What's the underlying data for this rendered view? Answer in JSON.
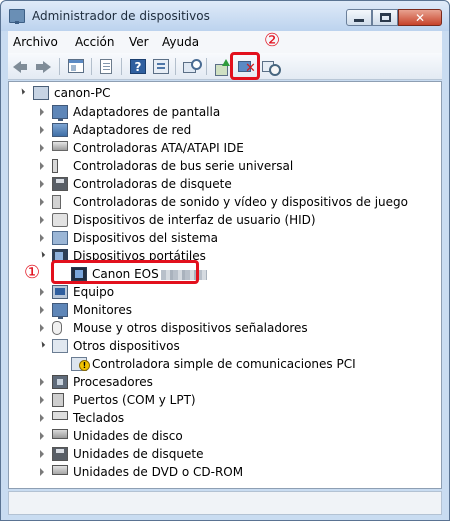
{
  "window": {
    "title": "Administrador de dispositivos"
  },
  "menu": [
    "Archivo",
    "Acción",
    "Ver",
    "Ayuda"
  ],
  "toolbar": {
    "buttons": [
      "back-icon",
      "forward-icon",
      "show-hide-tree-icon",
      "properties-doc-icon",
      "help-icon",
      "properties-icon",
      "scan-hardware-icon",
      "update-driver-icon",
      "uninstall-icon",
      "scan-changes-icon"
    ]
  },
  "callouts": {
    "first": "①",
    "second": "②"
  },
  "tree": {
    "root": "canon-PC",
    "items": [
      {
        "label": "Adaptadores de pantalla",
        "icon": "display-adapter-icon"
      },
      {
        "label": "Adaptadores de red",
        "icon": "network-adapter-icon"
      },
      {
        "label": "Controladoras ATA/ATAPI IDE",
        "icon": "ide-controller-icon"
      },
      {
        "label": "Controladoras de bus serie universal",
        "icon": "usb-icon"
      },
      {
        "label": "Controladoras de disquete",
        "icon": "floppy-controller-icon"
      },
      {
        "label": "Controladoras de sonido y vídeo y dispositivos de juego",
        "icon": "speaker-icon"
      },
      {
        "label": "Dispositivos de interfaz de usuario (HID)",
        "icon": "hid-icon"
      },
      {
        "label": "Dispositivos del sistema",
        "icon": "system-device-icon"
      },
      {
        "label": "Dispositivos portátiles",
        "icon": "portable-device-icon"
      },
      {
        "label": "Canon EOS",
        "icon": "camera-icon"
      },
      {
        "label": "Equipo",
        "icon": "computer-icon"
      },
      {
        "label": "Monitores",
        "icon": "monitor-icon"
      },
      {
        "label": "Mouse y otros dispositivos señaladores",
        "icon": "mouse-icon"
      },
      {
        "label": "Otros dispositivos",
        "icon": "other-devices-icon"
      },
      {
        "label": "Controladora simple de comunicaciones PCI",
        "icon": "warning-device-icon"
      },
      {
        "label": "Procesadores",
        "icon": "processor-icon"
      },
      {
        "label": "Puertos (COM y LPT)",
        "icon": "port-icon"
      },
      {
        "label": "Teclados",
        "icon": "keyboard-icon"
      },
      {
        "label": "Unidades de disco",
        "icon": "disk-drive-icon"
      },
      {
        "label": "Unidades de disquete",
        "icon": "floppy-drive-icon"
      },
      {
        "label": "Unidades de DVD o CD-ROM",
        "icon": "dvd-drive-icon"
      }
    ]
  },
  "colors": {
    "callout": "#e2101d",
    "frame": "#c9dcf1"
  }
}
